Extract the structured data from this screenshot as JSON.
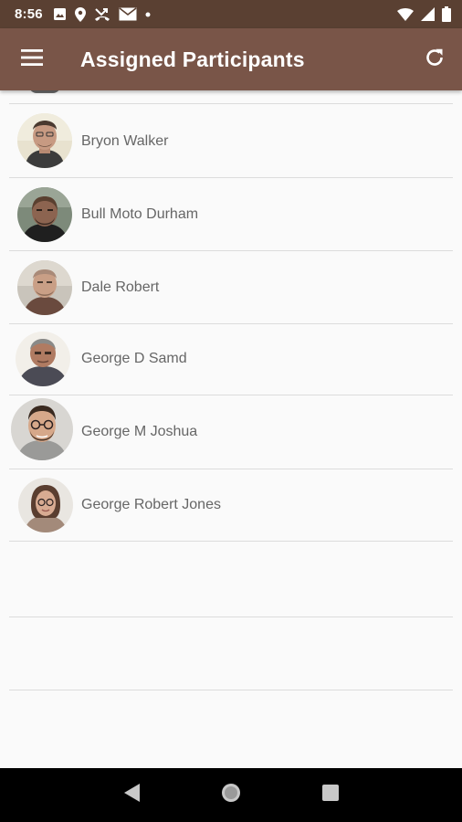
{
  "status_bar": {
    "time": "8:56",
    "icons_left": [
      "image-icon",
      "location-pin-icon",
      "missed-call-icon",
      "mail-icon",
      "dot-icon"
    ],
    "icons_right": [
      "wifi-icon",
      "signal-icon",
      "battery-icon"
    ]
  },
  "app_bar": {
    "title": "Assigned Participants",
    "background": "#795548",
    "menu_icon": "hamburger-menu-icon",
    "refresh_icon": "refresh-icon"
  },
  "participants": [
    {
      "name": "Bryon Walker"
    },
    {
      "name": "Bull Moto Durham"
    },
    {
      "name": "Dale Robert"
    },
    {
      "name": "George D Samd"
    },
    {
      "name": "George M Joshua"
    },
    {
      "name": "George Robert Jones"
    }
  ],
  "nav_bar": {
    "buttons": [
      "back-icon",
      "home-icon",
      "recents-icon"
    ]
  }
}
